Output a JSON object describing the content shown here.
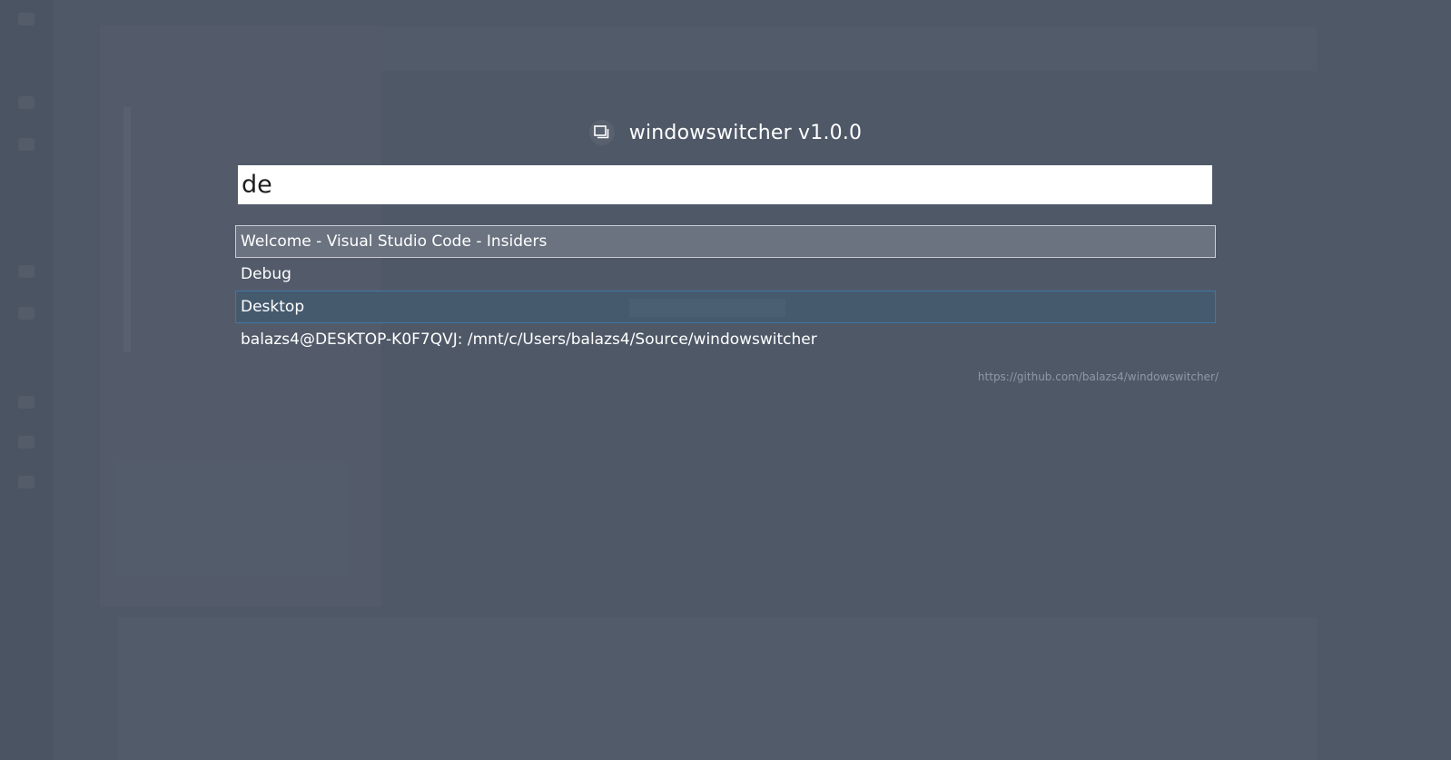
{
  "app": {
    "title": "windowswitcher v1.0.0",
    "icon": "window-stack-icon"
  },
  "search": {
    "value": "de",
    "placeholder": ""
  },
  "results": [
    {
      "label": "Welcome - Visual Studio Code - Insiders",
      "state": "selected"
    },
    {
      "label": "Debug",
      "state": "normal"
    },
    {
      "label": "Desktop",
      "state": "hover"
    },
    {
      "label": "balazs4@DESKTOP-K0F7QVJ: /mnt/c/Users/balazs4/Source/windowswitcher",
      "state": "normal"
    }
  ],
  "footer": {
    "repo_url": "https://github.com/balazs4/windowswitcher/"
  },
  "colors": {
    "overlay": "#4f5867",
    "selected_bg": "#6b7380",
    "selected_border": "#c9cdd3",
    "hover_bg": "#465a6e",
    "hover_border": "#3f77a6",
    "link": "#8f98a6"
  }
}
